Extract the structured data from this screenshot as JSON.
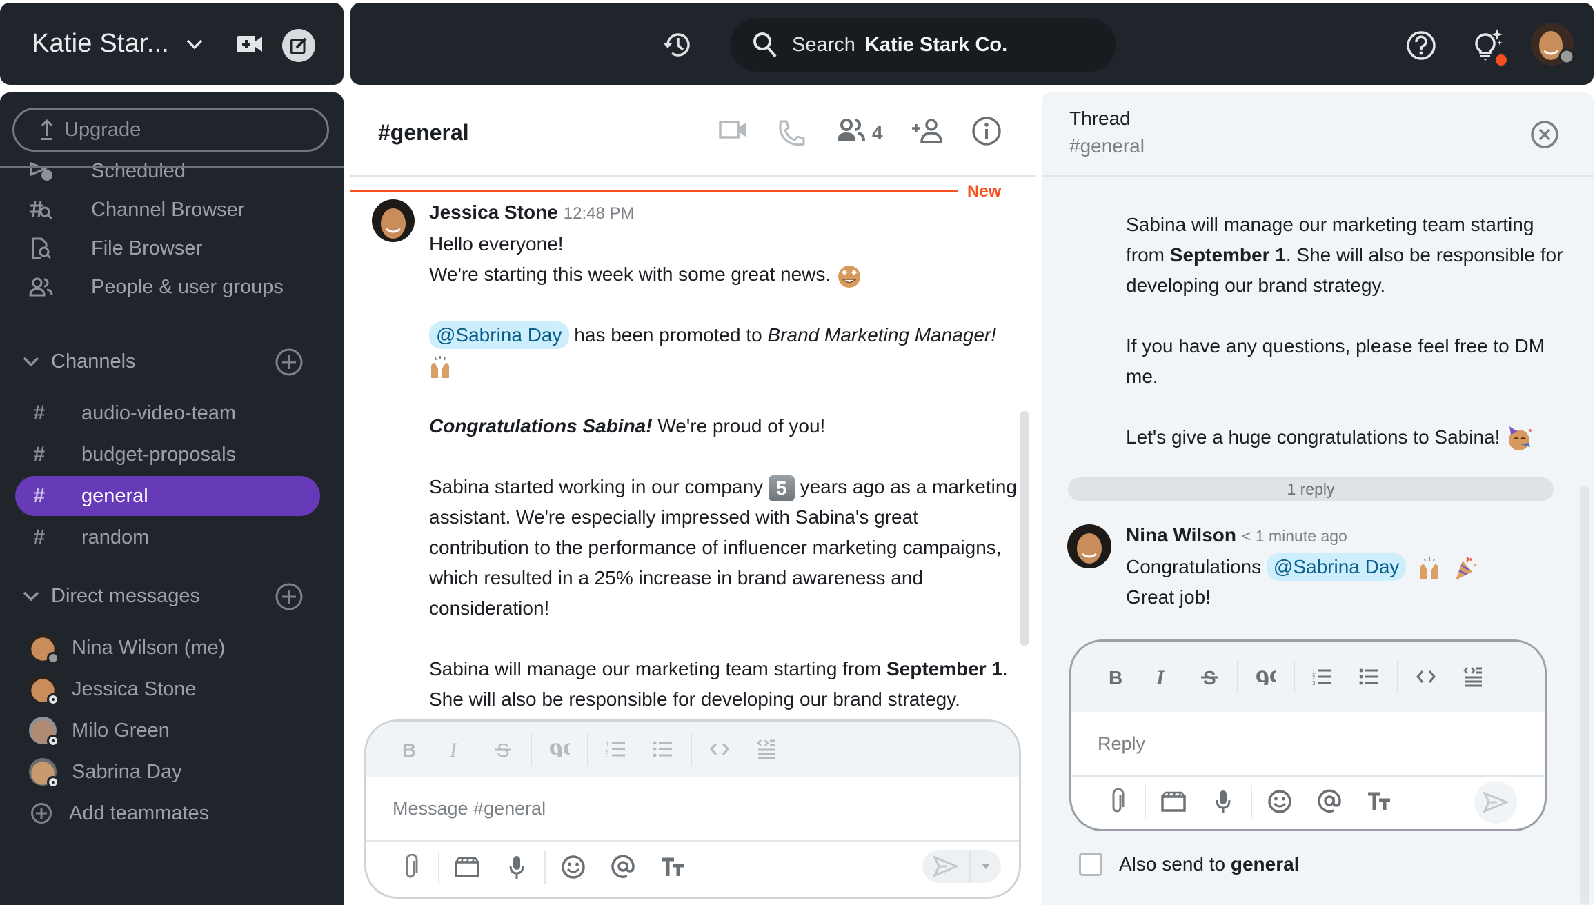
{
  "workspace": {
    "name": "Katie Star...",
    "icons": {
      "dropdown": "chevron-down-icon",
      "video": "video-add-icon",
      "compose": "compose-icon"
    }
  },
  "topbar": {
    "search_label": "Search",
    "search_scope": "Katie Stark Co.",
    "icons": {
      "history": "history-icon",
      "search": "search-icon",
      "help": "help-icon",
      "tips": "lightbulb-icon"
    },
    "accent": "#f4511e"
  },
  "sidebar": {
    "upgrade_label": "Upgrade",
    "nav_items": [
      {
        "label": "Scheduled",
        "icon": "scheduled-icon"
      },
      {
        "label": "Channel Browser",
        "icon": "channel-browser-icon"
      },
      {
        "label": "File Browser",
        "icon": "file-browser-icon"
      },
      {
        "label": "People & user groups",
        "icon": "people-icon"
      }
    ],
    "channels_header": "Channels",
    "channels": [
      {
        "label": "audio-video-team",
        "active": false
      },
      {
        "label": "budget-proposals",
        "active": false
      },
      {
        "label": "general",
        "active": true
      },
      {
        "label": "random",
        "active": false
      }
    ],
    "dm_header": "Direct messages",
    "dms": [
      {
        "label": "Nina Wilson (me)",
        "status": "away"
      },
      {
        "label": "Jessica Stone",
        "status": "offline"
      },
      {
        "label": "Milo Green",
        "status": "offline"
      },
      {
        "label": "Sabrina Day",
        "status": "offline"
      }
    ],
    "add_teammates": "Add teammates",
    "active_color": "#673ab7"
  },
  "channel": {
    "title": "#general",
    "member_count": "4",
    "new_label": "New"
  },
  "message": {
    "author": "Jessica Stone",
    "time": "12:48 PM",
    "line1": "Hello everyone!",
    "line2": "We're starting this week with some great news.",
    "mention": "@Sabrina Day",
    "promoted_text": " has been promoted to ",
    "promoted_role": "Brand Marketing Manager!",
    "congrats_bold": "Congratulations Sabina!",
    "congrats_rest": " We're proud of you!",
    "started_a": "Sabina started working in our company ",
    "years_num": "5",
    "started_b": " years ago as a marketing assistant. We're especially impressed with Sabina's great contribution to the performance of influencer marketing campaigns, which resulted in a 25% increase in brand awareness and consideration!",
    "manage_a": "Sabina will manage our marketing team starting from ",
    "manage_bold": "September 1",
    "manage_b": ". She will also be responsible for developing our brand strategy."
  },
  "composer": {
    "placeholder": "Message #general"
  },
  "thread": {
    "title": "Thread",
    "subtitle": "#general",
    "body_a": "Sabina will manage our marketing team starting from ",
    "body_bold": "September 1",
    "body_b": ". She will also be responsible for developing our brand strategy.",
    "body_dm": "If you have any questions, please feel free to DM me.",
    "body_congrats": "Let's give a huge congratulations to Sabina!",
    "reply_count": "1 reply",
    "reply": {
      "author": "Nina Wilson",
      "time": "< 1 minute ago",
      "text": "Congratulations",
      "mention": "@Sabrina Day",
      "line2": "Great job!"
    },
    "reply_placeholder": "Reply",
    "also_send_prefix": "Also send to ",
    "also_send_channel": "general"
  }
}
